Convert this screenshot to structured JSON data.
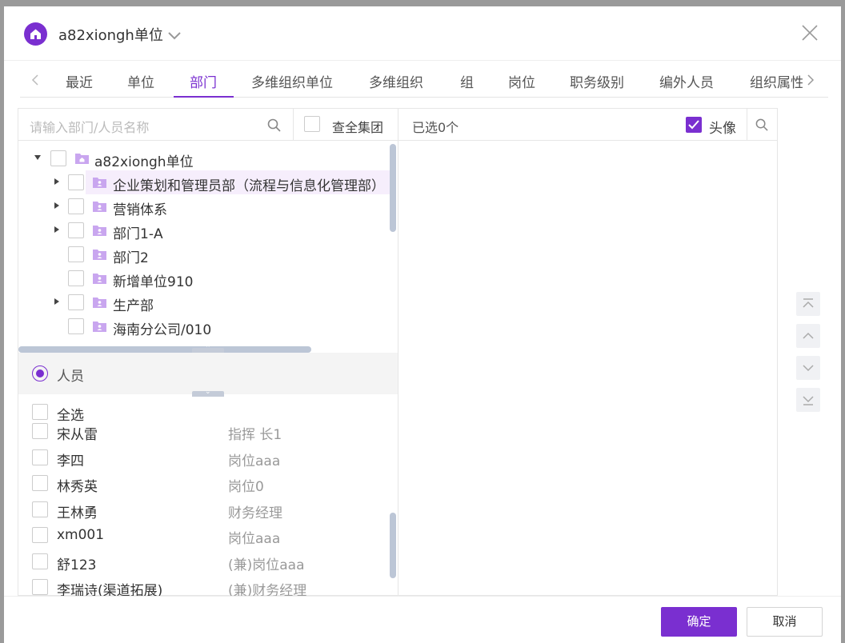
{
  "header": {
    "org_name": "a82xiongh单位"
  },
  "tabs": [
    "最近",
    "单位",
    "部门",
    "多维组织单位",
    "多维组织",
    "组",
    "岗位",
    "职务级别",
    "编外人员",
    "组织属性"
  ],
  "active_tab": "部门",
  "search": {
    "placeholder": "请输入部门/人员名称",
    "group_label": "查全集团"
  },
  "tree": {
    "root": "a82xiongh单位",
    "children": [
      "企业策划和管理员部（流程与信息化管理部）",
      "营销体系",
      "部门1-A",
      "部门2",
      "新增单位910",
      "生产部",
      "海南分公司/010"
    ]
  },
  "person_section": {
    "label": "人员",
    "select_all": "全选"
  },
  "people": [
    {
      "name": "宋从雷",
      "position": "指挥 长1"
    },
    {
      "name": "李四",
      "position": "岗位aaa"
    },
    {
      "name": "林秀英",
      "position": "岗位0"
    },
    {
      "name": "王林勇",
      "position": "财务经理"
    },
    {
      "name": "xm001",
      "position": "岗位aaa"
    },
    {
      "name": "舒123",
      "position": "(兼)岗位aaa"
    },
    {
      "name": "李瑞诗(渠道拓展)",
      "position": "(兼)财务经理"
    }
  ],
  "selected": {
    "count_label": "已选0个",
    "avatar_label": "头像"
  },
  "footer": {
    "confirm": "确定",
    "cancel": "取消"
  },
  "colors": {
    "accent": "#7a2fd0",
    "highlight": "#f6eefc",
    "scrollbar": "#bcc6d6"
  }
}
